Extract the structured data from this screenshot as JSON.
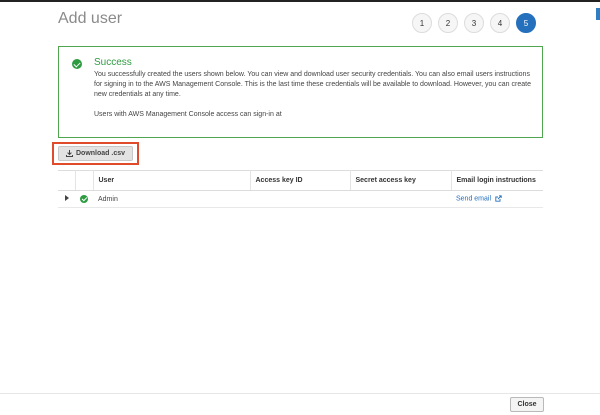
{
  "page": {
    "title": "Add user"
  },
  "steps": [
    "1",
    "2",
    "3",
    "4",
    "5"
  ],
  "active_step": "5",
  "success": {
    "title": "Success",
    "message": "You successfully created the users shown below. You can view and download user security credentials. You can also email users instructions for signing in to the AWS Management Console. This is the last time these credentials will be available to download. However, you can create new credentials at any time.",
    "signin_text": "Users with AWS Management Console access can sign-in at"
  },
  "toolbar": {
    "download_label": "Download .csv"
  },
  "table": {
    "headers": [
      "",
      "",
      "User",
      "Access key ID",
      "Secret access key",
      "Email login instructions"
    ],
    "rows": [
      {
        "user": "Admin",
        "access_key_id": "",
        "secret_access_key": "",
        "email_link": "Send email"
      }
    ]
  },
  "footer": {
    "close_label": "Close"
  },
  "colors": {
    "success_green": "#2e9b41",
    "active_step_blue": "#2470bd",
    "highlight_red": "#e04b2b",
    "link_blue": "#2470bd"
  },
  "icons": {
    "success": "check-circle-icon",
    "download": "download-icon",
    "expand": "caret-right-icon",
    "external": "external-link-icon"
  }
}
